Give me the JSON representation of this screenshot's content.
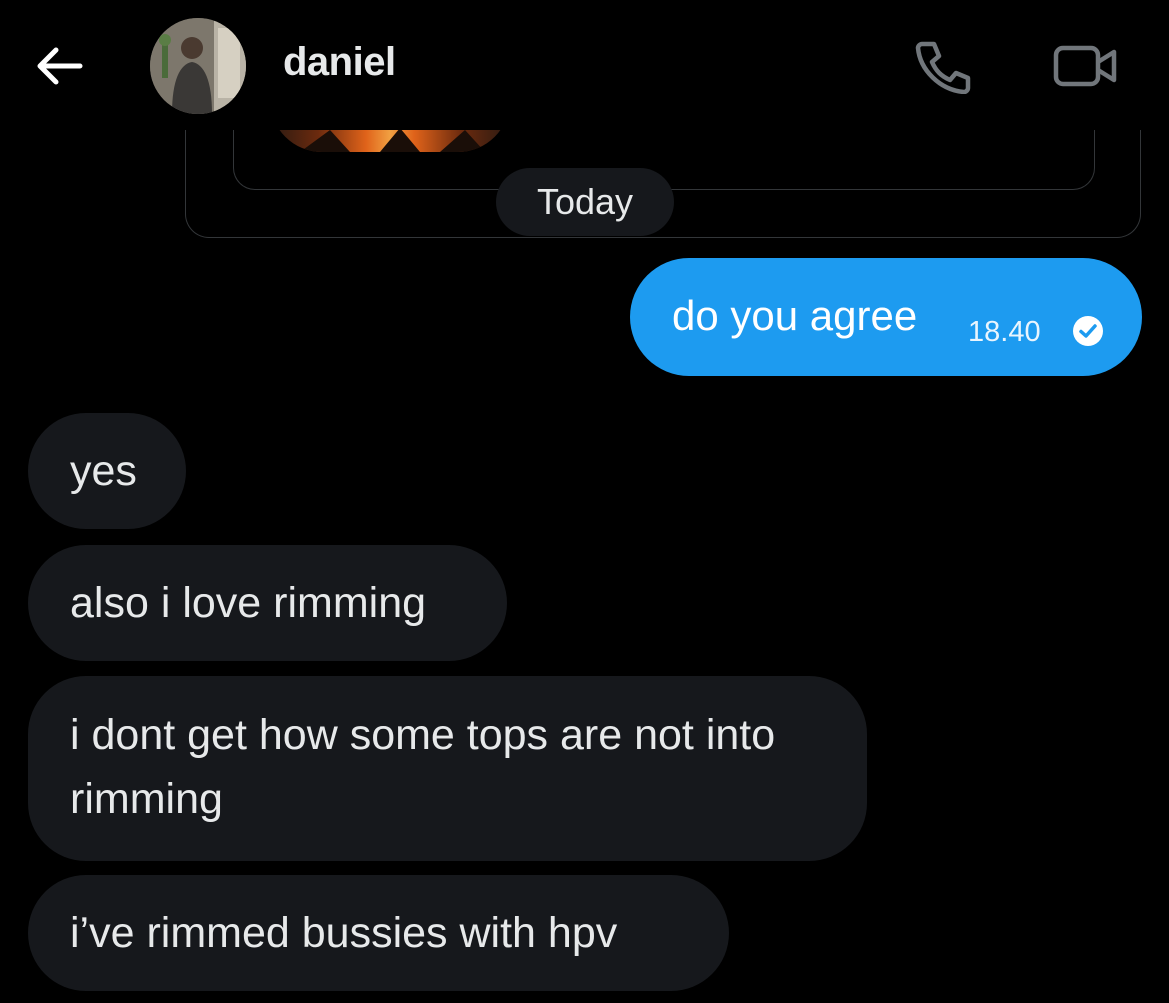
{
  "header": {
    "contact_name": "daniel",
    "back_icon": "arrow-left-icon",
    "call_icon": "phone-icon",
    "video_icon": "video-camera-icon"
  },
  "conversation": {
    "date_separator": "Today",
    "sent_messages": [
      {
        "text": "do you agree",
        "time": "18.40",
        "status_icon": "read-check-icon"
      }
    ],
    "received_messages": [
      {
        "text": "yes"
      },
      {
        "text": "also i love rimming"
      },
      {
        "text": "i dont get how some tops are not into rimming"
      },
      {
        "text": "i’ve rimmed bussies with hpv"
      }
    ]
  },
  "colors": {
    "background": "#000000",
    "sent_bubble": "#1d9bf0",
    "received_bubble": "#16181c",
    "text": "#e7e9ea",
    "icon": "#71767b"
  }
}
